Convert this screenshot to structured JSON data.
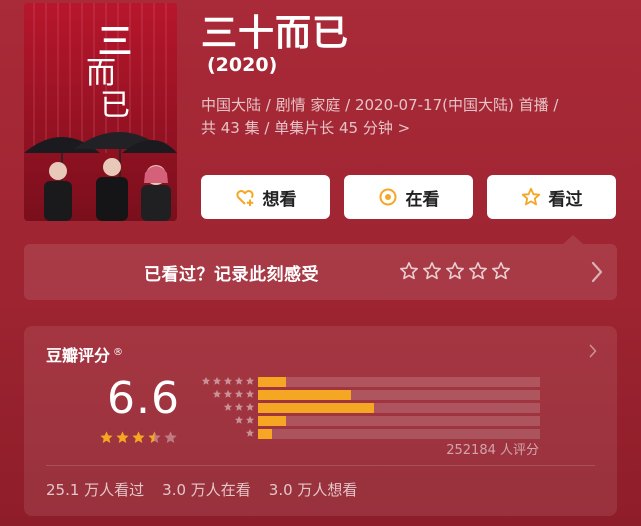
{
  "header": {
    "title": "三十而已",
    "year": "(2020)",
    "meta_line1": "中国大陆 / 剧情 家庭 / 2020-07-17(中国大陆) 首播 /",
    "meta_line2": "共 43 集 / 单集片长 45 分钟 >"
  },
  "poster": {
    "title_art": "三十而已"
  },
  "actions": [
    {
      "label": "想看",
      "icon": "heart-plus-icon"
    },
    {
      "label": "在看",
      "icon": "target-circle-icon"
    },
    {
      "label": "看过",
      "icon": "star-outline-icon"
    }
  ],
  "record": {
    "prompt": "已看过？记录此刻感受",
    "star_count": 5
  },
  "rating": {
    "title": "豆瓣评分",
    "registered": "®",
    "score": "6.6",
    "score_value": 6.6,
    "stars_filled": 3.5,
    "vote_count": "252184 人评分",
    "distribution": [
      {
        "stars": 5,
        "fraction": 0.1
      },
      {
        "stars": 4,
        "fraction": 0.33
      },
      {
        "stars": 3,
        "fraction": 0.41
      },
      {
        "stars": 2,
        "fraction": 0.1
      },
      {
        "stars": 1,
        "fraction": 0.05
      }
    ],
    "counts": [
      "25.1 万人看过",
      "3.0 万人在看",
      "3.0 万人想看"
    ]
  },
  "colors": {
    "accent": "#f5a623",
    "background": "#a22834"
  }
}
